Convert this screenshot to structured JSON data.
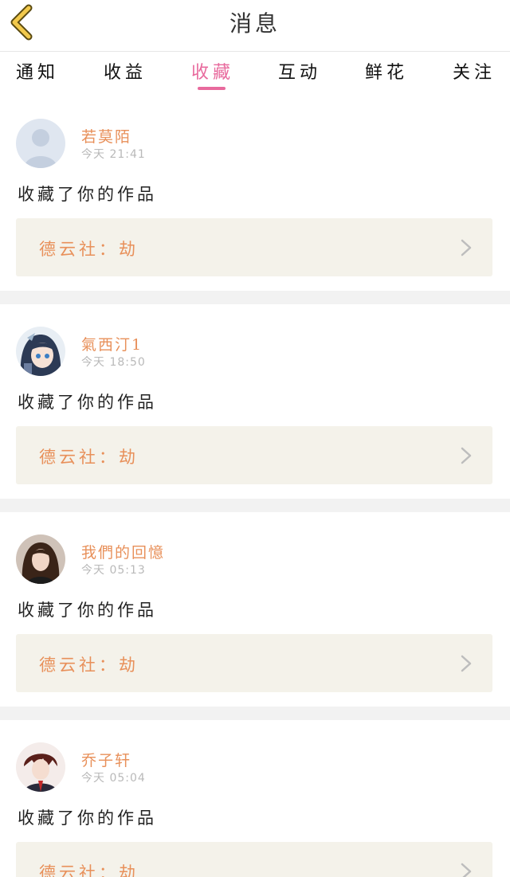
{
  "header": {
    "title": "消息",
    "back_icon": "chevron-left-icon",
    "back_color": "#f2c94c"
  },
  "tabs": [
    {
      "label": "通知",
      "active": false
    },
    {
      "label": "收益",
      "active": false
    },
    {
      "label": "收藏",
      "active": true
    },
    {
      "label": "互动",
      "active": false
    },
    {
      "label": "鲜花",
      "active": false
    },
    {
      "label": "关注",
      "active": false
    }
  ],
  "accent_color": "#e86a9d",
  "name_color": "#e8905a",
  "messages": [
    {
      "username": "若莫陌",
      "time": "今天 21:41",
      "action": "收藏了你的作品",
      "work": "德云社：劫",
      "avatar": "default-avatar"
    },
    {
      "username": "氣西汀1",
      "time": "今天 18:50",
      "action": "收藏了你的作品",
      "work": "德云社：劫",
      "avatar": "anime-girl-avatar"
    },
    {
      "username": "我們的回憶",
      "time": "今天 05:13",
      "action": "收藏了你的作品",
      "work": "德云社：劫",
      "avatar": "woman-photo-avatar"
    },
    {
      "username": "乔子轩",
      "time": "今天 05:04",
      "action": "收藏了你的作品",
      "work": "德云社：劫",
      "avatar": "anime-boy-avatar"
    }
  ]
}
